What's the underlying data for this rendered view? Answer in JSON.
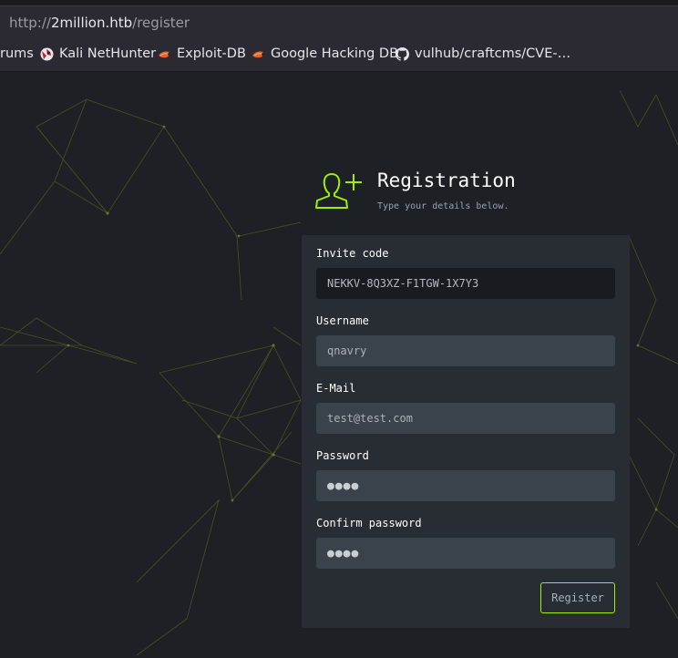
{
  "browser": {
    "url_prefix": "http://",
    "url_host": "2million.htb",
    "url_path": "/register",
    "bookmarks": [
      {
        "label": "rums",
        "icon": "none"
      },
      {
        "label": "Kali NetHunter",
        "icon": "kali-nethunter-icon"
      },
      {
        "label": "Exploit-DB",
        "icon": "exploit-db-icon"
      },
      {
        "label": "Google Hacking DB",
        "icon": "exploit-db-icon"
      },
      {
        "label": "vulhub/craftcms/CVE-…",
        "icon": "github-icon"
      }
    ]
  },
  "registration": {
    "title": "Registration",
    "subtitle": "Type your details below.",
    "icon": "add-user-icon",
    "fields": {
      "invite_code": {
        "label": "Invite code",
        "value": "NEKKV-8Q3XZ-F1TGW-1X7Y3"
      },
      "username": {
        "label": "Username",
        "value": "qnavry"
      },
      "email": {
        "label": "E-Mail",
        "value": "test@test.com"
      },
      "password": {
        "label": "Password",
        "value": "●●●●"
      },
      "confirm_password": {
        "label": "Confirm password",
        "value": "●●●●"
      }
    },
    "submit_label": "Register"
  },
  "colors": {
    "accent": "#9fef00",
    "background": "#1d2126",
    "panel": "#272d33",
    "input": "#3a434b",
    "browser_chrome": "#2b2a33"
  }
}
